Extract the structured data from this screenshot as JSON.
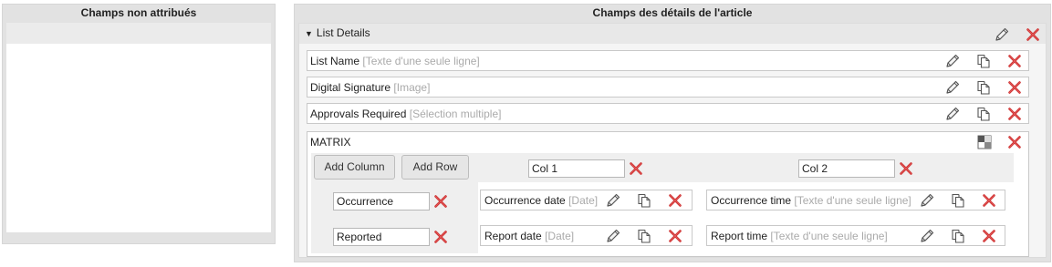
{
  "left_panel": {
    "title": "Champs non attribués"
  },
  "right_panel": {
    "title": "Champs des détails de l'article",
    "section": {
      "title": "List Details"
    },
    "fields": [
      {
        "name": "List Name",
        "type": "[Texte d'une seule ligne]"
      },
      {
        "name": "Digital Signature",
        "type": "[Image]"
      },
      {
        "name": "Approvals Required",
        "type": "[Sélection multiple]"
      }
    ],
    "matrix": {
      "label": "MATRIX",
      "add_column_label": "Add Column",
      "add_row_label": "Add Row",
      "columns": [
        "Col 1",
        "Col 2"
      ],
      "rows": [
        "Occurrence",
        "Reported"
      ],
      "cells": [
        [
          {
            "name": "Occurrence date",
            "type": "[Date]"
          },
          {
            "name": "Occurrence time",
            "type": "[Texte d'une seule ligne]"
          }
        ],
        [
          {
            "name": "Report date",
            "type": "[Date]"
          },
          {
            "name": "Report time",
            "type": "[Texte d'une seule ligne]"
          }
        ]
      ]
    }
  },
  "icons": {
    "edit": "pencil-icon",
    "copy": "copy-icon",
    "delete": "close-icon",
    "matrix": "matrix-grid-icon"
  },
  "colors": {
    "delete": "#cc2b2b",
    "hint": "#aaaaaa"
  }
}
